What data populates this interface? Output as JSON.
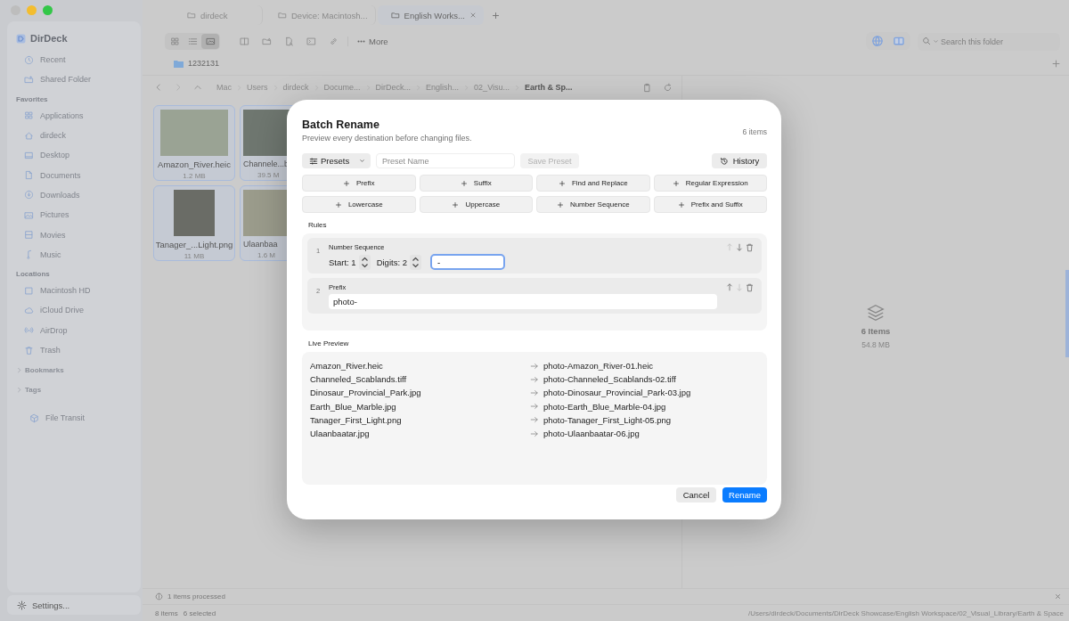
{
  "window": {
    "tabs": [
      {
        "label": "dirdeck",
        "selected": false
      },
      {
        "label": "Device: Macintosh...",
        "selected": false
      },
      {
        "label": "English Works...",
        "selected": true
      }
    ]
  },
  "sidebar": {
    "app_name": "DirDeck",
    "top_items": [
      "Recent",
      "Shared Folder"
    ],
    "sections": [
      {
        "title": "Favorites",
        "items": [
          "Applications",
          "dirdeck",
          "Desktop",
          "Documents",
          "Downloads",
          "Pictures",
          "Movies",
          "Music"
        ]
      },
      {
        "title": "Locations",
        "items": [
          "Macintosh HD",
          "iCloud Drive",
          "AirDrop",
          "Trash"
        ]
      }
    ],
    "groups": [
      {
        "title": "Bookmarks",
        "expanded": false
      },
      {
        "title": "Tags",
        "expanded": false
      }
    ],
    "extra_item": "File Transit",
    "settings": "Settings..."
  },
  "toolbar": {
    "view_modes": [
      {
        "selected": false
      },
      {
        "selected": false
      },
      {
        "selected": true
      }
    ],
    "more": "More",
    "search": {
      "placeholder": "Search this folder"
    }
  },
  "favorites_bar": {
    "folder": "1232131"
  },
  "path_bar": {
    "crumbs": [
      {
        "label": "Mac",
        "current": false
      },
      {
        "label": "Users",
        "current": false
      },
      {
        "label": "dirdeck",
        "current": false
      },
      {
        "label": "Docume...",
        "current": false
      },
      {
        "label": "DirDeck...",
        "current": false
      },
      {
        "label": "English...",
        "current": false
      },
      {
        "label": "02_Visu...",
        "current": false
      },
      {
        "label": "Earth & Sp...",
        "current": true
      }
    ]
  },
  "files": [
    {
      "name": "Amazon_River.heic",
      "size": "1.2 MB",
      "selected": true
    },
    {
      "name": "Channele...b",
      "size": "39.5 M",
      "selected": true
    },
    {
      "name": "Tanager_...Light.png",
      "size": "11 MB",
      "selected": true
    },
    {
      "name": "Ulaanbaa",
      "size": "1.6 M",
      "selected": true
    }
  ],
  "details": {
    "title": "6 Items",
    "size": "54.8 MB"
  },
  "status_bar": {
    "message": "1 items processed",
    "count": "8 items",
    "selected": "6 selected",
    "path": "/Users/dirdeck/Documents/DirDeck Showcase/English Workspace/02_Visual_Library/Earth & Space"
  },
  "dialog": {
    "title": "Batch Rename",
    "subtitle": "Preview every destination before changing files.",
    "count": "6 items",
    "presets": "Presets",
    "preset_name": {
      "placeholder": "Preset Name"
    },
    "save_preset": {
      "label": "Save Preset",
      "disabled": true
    },
    "history": "History",
    "add_rules": [
      "Prefix",
      "Suffix",
      "Find and Replace",
      "Regular Expression",
      "Lowercase",
      "Uppercase",
      "Number Sequence",
      "Prefix and Suffix"
    ],
    "rules_label": "Rules",
    "rules": [
      {
        "kind": "number_sequence",
        "index": "1",
        "title": "Number Sequence",
        "start": "Start: 1",
        "digits": "Digits: 2",
        "value": "-",
        "focused": true,
        "up_enabled": false,
        "down_enabled": true
      },
      {
        "kind": "prefix",
        "index": "2",
        "title": "Prefix",
        "value": "photo-",
        "focused": false,
        "up_enabled": true,
        "down_enabled": false
      }
    ],
    "preview_label": "Live Preview",
    "preview": [
      {
        "from": "Amazon_River.heic",
        "to": "photo-Amazon_River-01.heic"
      },
      {
        "from": "Channeled_Scablands.tiff",
        "to": "photo-Channeled_Scablands-02.tiff"
      },
      {
        "from": "Dinosaur_Provincial_Park.jpg",
        "to": "photo-Dinosaur_Provincial_Park-03.jpg"
      },
      {
        "from": "Earth_Blue_Marble.jpg",
        "to": "photo-Earth_Blue_Marble-04.jpg"
      },
      {
        "from": "Tanager_First_Light.png",
        "to": "photo-Tanager_First_Light-05.png"
      },
      {
        "from": "Ulaanbaatar.jpg",
        "to": "photo-Ulaanbaatar-06.jpg"
      }
    ],
    "cancel": "Cancel",
    "rename": "Rename"
  }
}
